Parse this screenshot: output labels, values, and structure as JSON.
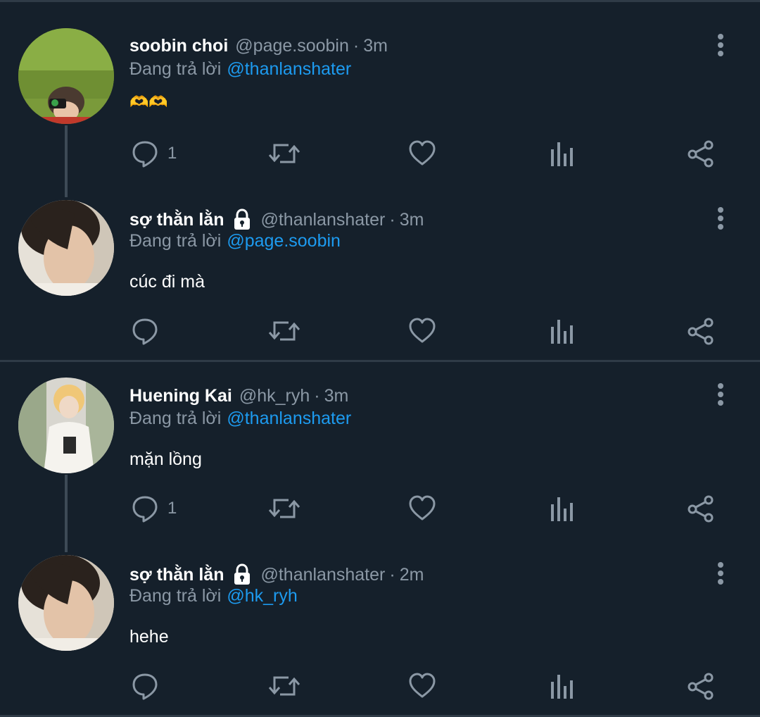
{
  "tweets": [
    {
      "name": "soobin choi",
      "handle": "@page.soobin",
      "separator": "·",
      "time": "3m",
      "replying_prefix": "Đang trả lời",
      "replying_to": "@thanlanshater",
      "text": "🫶🫶",
      "reply_count": "1",
      "locked": false
    },
    {
      "name": "sợ thằn lằn",
      "handle": "@thanlanshater",
      "separator": "·",
      "time": "3m",
      "replying_prefix": "Đang trả lời",
      "replying_to": "@page.soobin",
      "text": "cúc đi mà",
      "reply_count": "",
      "locked": true
    },
    {
      "name": "Huening Kai",
      "handle": "@hk_ryh",
      "separator": "·",
      "time": "3m",
      "replying_prefix": "Đang trả lời",
      "replying_to": "@thanlanshater",
      "text": "mặn lồng",
      "reply_count": "1",
      "locked": false
    },
    {
      "name": "sợ thằn lằn",
      "handle": "@thanlanshater",
      "separator": "·",
      "time": "2m",
      "replying_prefix": "Đang trả lời",
      "replying_to": "@hk_ryh",
      "text": "hehe",
      "reply_count": "",
      "locked": true
    }
  ],
  "icons": {
    "reply": "reply-icon",
    "retweet": "retweet-icon",
    "like": "heart-icon",
    "views": "analytics-icon",
    "share": "share-icon",
    "more": "more-vertical-icon",
    "lock": "lock-icon"
  },
  "colors": {
    "background": "#15202b",
    "text": "#ffffff",
    "muted": "#8b98a5",
    "accent": "#1d9bf0",
    "divider": "#2f3b47"
  }
}
